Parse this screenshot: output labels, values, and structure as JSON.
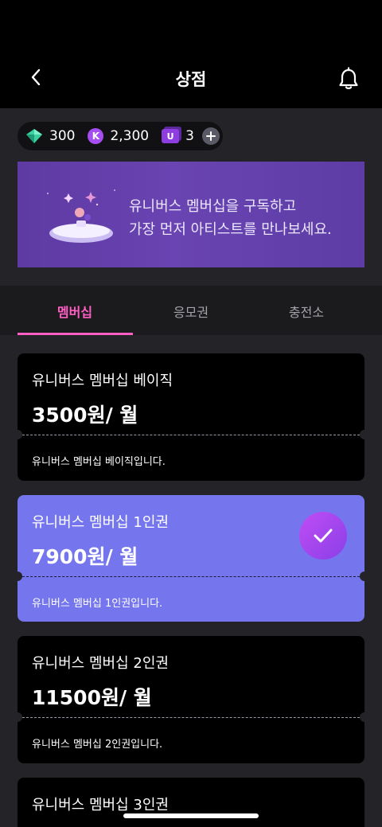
{
  "header": {
    "title": "상점"
  },
  "currencies": {
    "gems": "300",
    "k_coins": "2,300",
    "u_tickets": "3",
    "k_badge": "K",
    "u_badge": "U"
  },
  "banner": {
    "line1": "유니버스 멤버십을 구독하고",
    "line2": "가장 먼저 아티스트를 만나보세요."
  },
  "tabs": [
    {
      "label": "멤버십",
      "active": true
    },
    {
      "label": "응모권",
      "active": false
    },
    {
      "label": "충전소",
      "active": false
    }
  ],
  "plans": [
    {
      "name": "유니버스 멤버십 베이직",
      "price": "3500원/ 월",
      "desc": "유니버스 멤버십 베이직입니다.",
      "selected": false
    },
    {
      "name": "유니버스 멤버십 1인권",
      "price": "7900원/ 월",
      "desc": "유니버스 멤버십 1인권입니다.",
      "selected": true
    },
    {
      "name": "유니버스 멤버십 2인권",
      "price": "11500원/ 월",
      "desc": "유니버스 멤버십 2인권입니다.",
      "selected": false
    },
    {
      "name": "유니버스 멤버십 3인권",
      "price": "",
      "desc": "",
      "selected": false
    }
  ],
  "colors": {
    "accent_pink": "#ff5ec4",
    "selected_card": "#7576ee",
    "check_circle": "#b447f2",
    "banner_purple": "#6944b2"
  },
  "icons": {
    "back": "chevron-left-icon",
    "bell": "bell-icon",
    "gem": "gem-icon",
    "k_coin": "k-coin-icon",
    "u_ticket": "u-ticket-icon",
    "add": "plus-icon",
    "check": "check-icon"
  }
}
